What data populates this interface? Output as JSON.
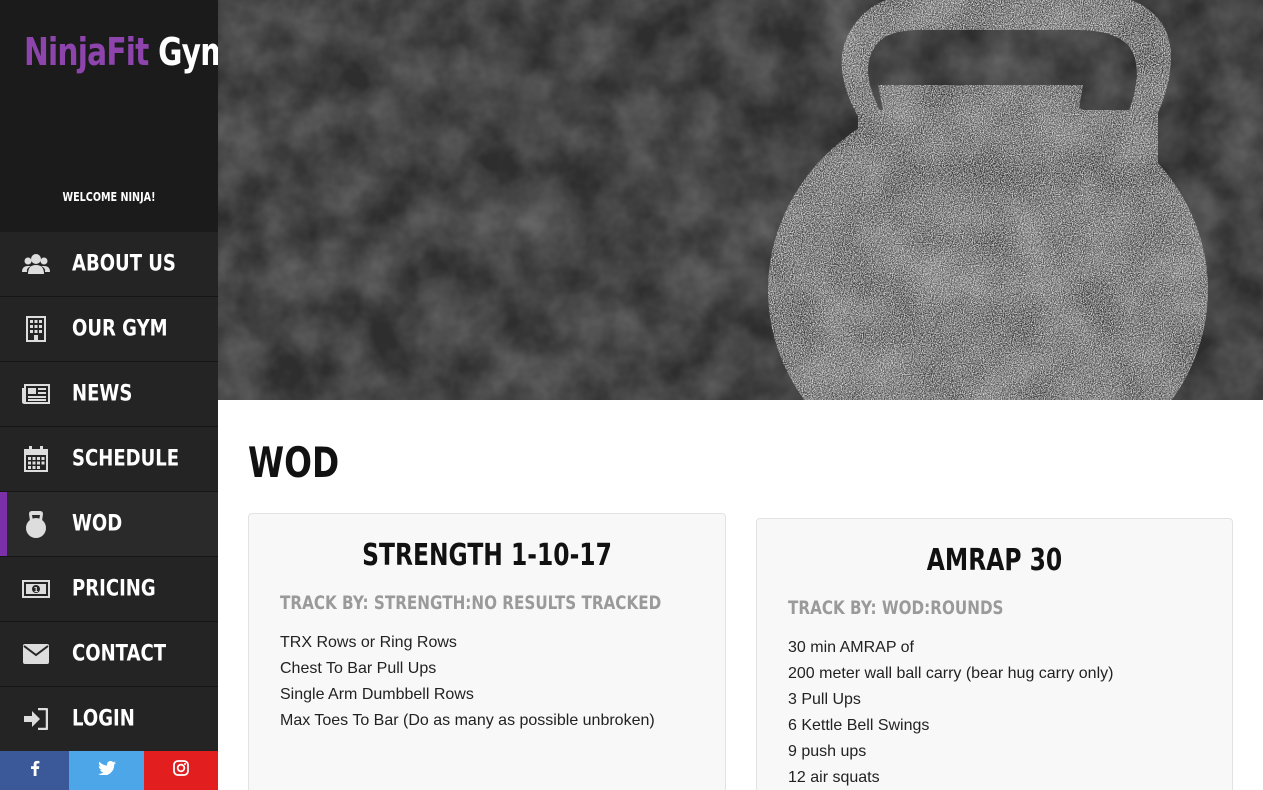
{
  "brand": {
    "part1": "Ninja",
    "part2": "Fit",
    "part3": " Gym"
  },
  "welcome": "WELCOME NINJA!",
  "nav": [
    {
      "label": "ABOUT US",
      "icon": "users-icon"
    },
    {
      "label": "OUR GYM",
      "icon": "building-icon"
    },
    {
      "label": "NEWS",
      "icon": "newspaper-icon"
    },
    {
      "label": "SCHEDULE",
      "icon": "calendar-icon"
    },
    {
      "label": "WOD",
      "icon": "kettlebell-icon",
      "active": true
    },
    {
      "label": "PRICING",
      "icon": "money-icon"
    },
    {
      "label": "CONTACT",
      "icon": "envelope-icon"
    },
    {
      "label": "LOGIN",
      "icon": "sign-in-icon"
    }
  ],
  "social": [
    {
      "name": "facebook-icon",
      "color": "#3b5998"
    },
    {
      "name": "twitter-icon",
      "color": "#4ca6e8"
    },
    {
      "name": "instagram-icon",
      "color": "#e21e1e"
    }
  ],
  "colors": {
    "accent": "#7b2fa8",
    "brand_purple": "#8e44ad",
    "sidebar": "#1b1b1b"
  },
  "main": {
    "title": "WOD",
    "cards": [
      {
        "title": "STRENGTH 1-10-17",
        "track": "TRACK BY: STRENGTH:NO RESULTS TRACKED",
        "lines": [
          "TRX Rows or Ring Rows",
          "Chest To Bar Pull Ups",
          "Single Arm Dumbbell Rows",
          "Max Toes To Bar (Do as many as possible unbroken)"
        ]
      },
      {
        "title": "AMRAP 30",
        "track": "TRACK BY: WOD:ROUNDS",
        "lines": [
          "30 min AMRAP of",
          "200 meter wall ball carry (bear hug carry only)",
          "3 Pull Ups",
          "6 Kettle Bell Swings",
          "9 push ups",
          "12 air squats"
        ]
      }
    ]
  }
}
